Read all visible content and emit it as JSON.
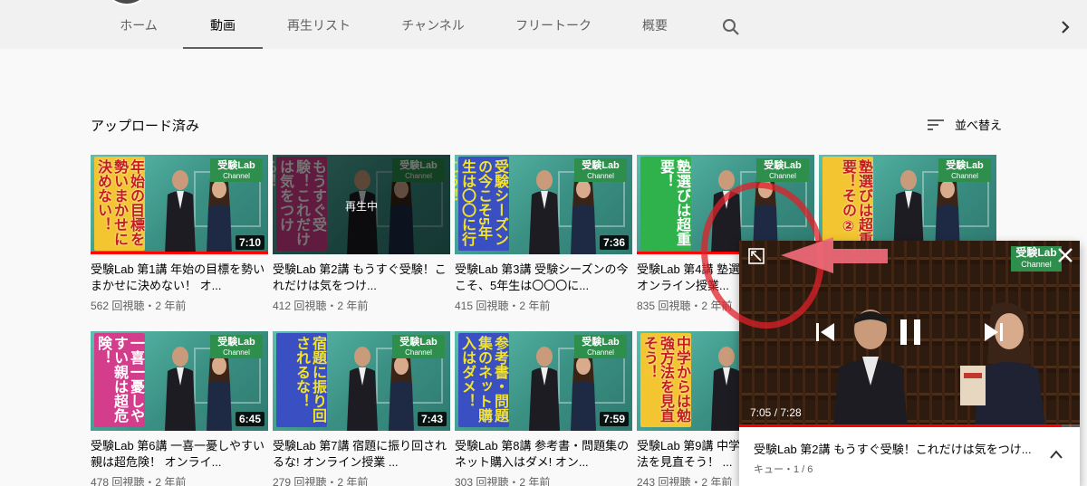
{
  "nav": {
    "tabs": [
      {
        "label": "ホーム"
      },
      {
        "label": "動画"
      },
      {
        "label": "再生リスト"
      },
      {
        "label": "チャンネル"
      },
      {
        "label": "フリートーク"
      },
      {
        "label": "概要"
      }
    ],
    "active_tab": "動画",
    "search_icon": "search-icon",
    "next_icon": "chevron-right-icon"
  },
  "section": {
    "title": "アップロード済み",
    "sort_label": "並べ替え"
  },
  "videos": [
    {
      "thumb_text": "年始の目標を勢いまかせに決めない！",
      "duration": "7:10",
      "title": "受験Lab 第1講 年始の目標を勢いまかせに決めない！ オ...",
      "meta": "562 回視聴・2 年前",
      "watched": 1.0,
      "theme": "yellow"
    },
    {
      "thumb_text": "もうすぐ受験！これだけは気をつける！",
      "duration": "",
      "playing_label": "再生中",
      "title": "受験Lab 第2講 もうすぐ受験！これだけは気をつけ...",
      "meta": "412 回視聴・2 年前",
      "watched": 0,
      "theme": "pink"
    },
    {
      "thumb_text": "受験シーズンの今こそ5年生は〇〇に行こう！",
      "duration": "7:36",
      "title": "受験Lab 第3講 受験シーズンの今こそ、5年生は〇〇〇に...",
      "meta": "415 回視聴・2 年前",
      "watched": 0,
      "theme": "blue"
    },
    {
      "thumb_text": "塾選びは超重要！",
      "duration": "",
      "title": "受験Lab 第4講 塾選びは超重要！ オンライン授業...",
      "meta": "835 回視聴・2 年前",
      "watched": 0.6,
      "theme": "green"
    },
    {
      "thumb_text": "塾選びは超重要！その②",
      "duration": "",
      "title": "",
      "meta": "",
      "watched": 0,
      "theme": "yellow"
    },
    {
      "thumb_text": "一喜一憂しやすい親は超危険！",
      "duration": "6:45",
      "title": "受験Lab 第6講 一喜一憂しやすい親は超危険！ オンライ...",
      "meta": "478 回視聴・2 年前",
      "watched": 0,
      "theme": "pink"
    },
    {
      "thumb_text": "宿題に振り回されるな！",
      "duration": "7:43",
      "title": "受験Lab 第7講 宿題に振り回されるな! オンライン授業 ...",
      "meta": "279 回視聴・2 年前",
      "watched": 0,
      "theme": "blue"
    },
    {
      "thumb_text": "参考書・問題集のネット購入はダメ！",
      "duration": "7:59",
      "title": "受験Lab 第8講 参考書・問題集のネット購入はダメ! オン...",
      "meta": "303 回視聴・2 年前",
      "watched": 0,
      "theme": "blue"
    },
    {
      "thumb_text": "中学からは勉強方法を見直そう！",
      "duration": "",
      "title": "受験Lab 第9講 中学からは勉強方法を見直そう！ ...",
      "meta": "243 回視聴・2 年前",
      "watched": 0,
      "theme": "yellow"
    }
  ],
  "thumb_logo": {
    "main": "受験Lab",
    "sub": "Channel"
  },
  "mini_player": {
    "time": "7:05 / 7:28",
    "progress": 0.948,
    "title": "受験Lab 第2講 もうすぐ受験！これだけは気をつけ...",
    "queue": "キュー・1 / 6",
    "logo_main": "受験Lab",
    "logo_sub": "Channel",
    "icons": [
      "expand-icon",
      "close-icon",
      "previous-icon",
      "pause-icon",
      "next-track-icon",
      "chevron-up-icon"
    ]
  },
  "annotation": {
    "arrow_color": "#f06a7a",
    "circle_color": "#e0202a"
  }
}
